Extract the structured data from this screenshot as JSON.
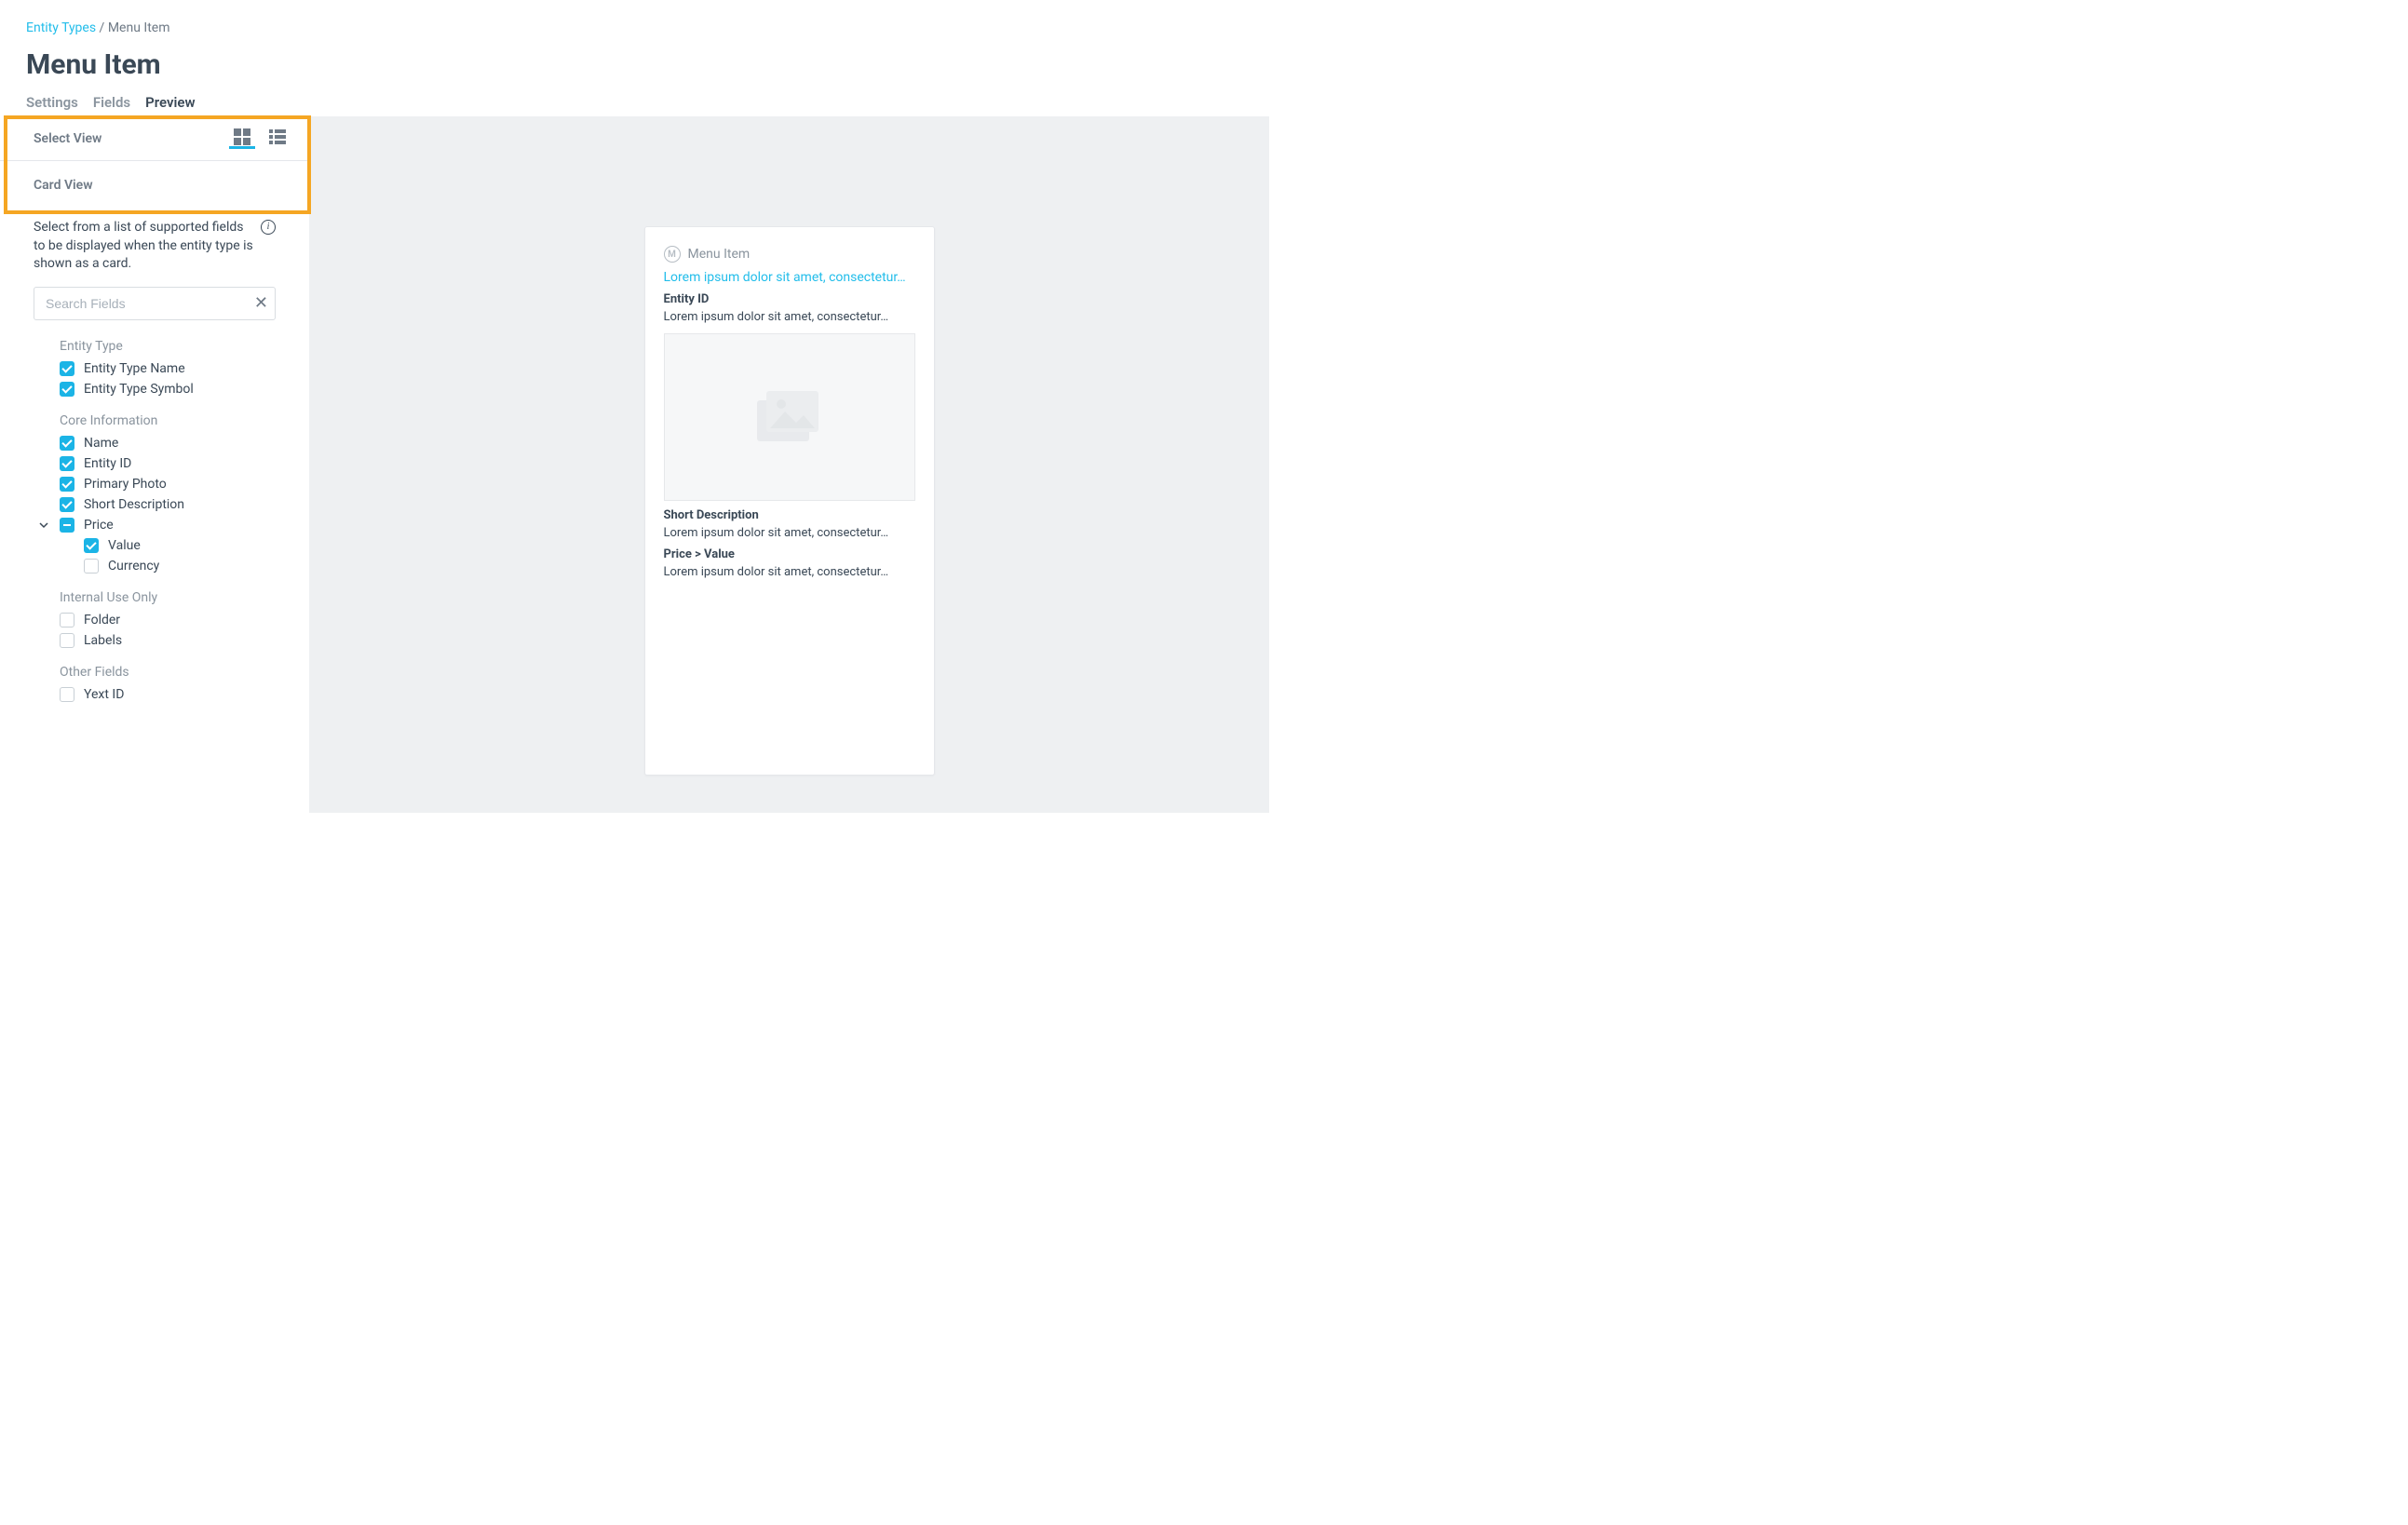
{
  "breadcrumb": {
    "root": "Entity Types",
    "sep": " / ",
    "current": "Menu Item"
  },
  "page_title": "Menu Item",
  "tabs": {
    "settings": "Settings",
    "fields": "Fields",
    "preview": "Preview"
  },
  "sidebar": {
    "select_view_label": "Select View",
    "card_view_label": "Card View",
    "help_text": "Select from a list of supported fields to be displayed when the entity type is shown as a card.",
    "search_placeholder": "Search Fields",
    "groups": {
      "entity_type": {
        "title": "Entity Type",
        "items": {
          "name": "Entity Type Name",
          "symbol": "Entity Type Symbol"
        }
      },
      "core": {
        "title": "Core Information",
        "items": {
          "name": "Name",
          "entity_id": "Entity ID",
          "primary_photo": "Primary Photo",
          "short_desc": "Short Description",
          "price": "Price",
          "value": "Value",
          "currency": "Currency"
        }
      },
      "internal": {
        "title": "Internal Use Only",
        "items": {
          "folder": "Folder",
          "labels": "Labels"
        }
      },
      "other": {
        "title": "Other Fields",
        "items": {
          "yext_id": "Yext ID"
        }
      }
    }
  },
  "preview": {
    "entity_type_label": "Menu Item",
    "link_text": "Lorem ipsum dolor sit amet, consectetur…",
    "entity_id_label": "Entity ID",
    "entity_id_value": "Lorem ipsum dolor sit amet, consectetur…",
    "short_desc_label": "Short Description",
    "short_desc_value": "Lorem ipsum dolor sit amet, consectetur…",
    "price_value_label": "Price > Value",
    "price_value_value": "Lorem ipsum dolor sit amet, consectetur…"
  }
}
